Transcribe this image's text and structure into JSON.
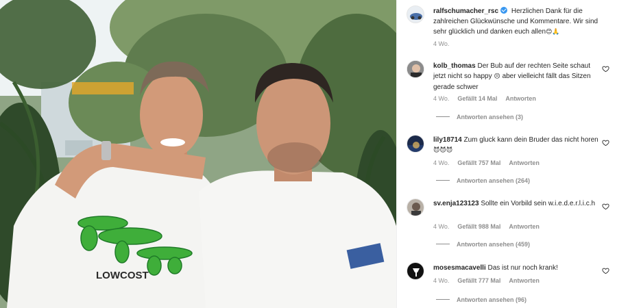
{
  "post": {
    "logo_text": "LOWCOST",
    "caption": {
      "username": "ralfschumacher_rsc",
      "text": "Herzlichen Dank für die zahlreichen Glückwünsche und Kommentare. Wir sind sehr glücklich und danken euch allen",
      "emojis": "😊🙏",
      "time": "4 Wo."
    }
  },
  "comments": [
    {
      "username": "kolb_thomas",
      "text_before": "Der Bub auf der rechten Seite schaut jetzt nicht so happy",
      "emoji": "😣",
      "text_after": "aber vielleicht fällt das Sitzen gerade schwer",
      "time": "4 Wo.",
      "likes": "Gefällt 14 Mal",
      "reply_label": "Antworten",
      "view_replies": "Antworten ansehen (3)"
    },
    {
      "username": "lily18714",
      "text_before": "Zum gluck kann dein Bruder das nicht horen",
      "emoji": "😈😈😈",
      "text_after": "",
      "time": "4 Wo.",
      "likes": "Gefällt 757 Mal",
      "reply_label": "Antworten",
      "view_replies": "Antworten ansehen (264)"
    },
    {
      "username": "sv.enja123123",
      "text_before": "Sollte ein Vorbild sein w.i.e.d.e.r.l.i.c.h",
      "emoji": "",
      "text_after": "",
      "time": "4 Wo.",
      "likes": "Gefällt 988 Mal",
      "reply_label": "Antworten",
      "view_replies": "Antworten ansehen (459)"
    },
    {
      "username": "mosesmacavelli",
      "text_before": "Das ist nur noch krank!",
      "emoji": "",
      "text_after": "",
      "time": "4 Wo.",
      "likes": "Gefällt 777 Mal",
      "reply_label": "Antworten",
      "view_replies": "Antworten ansehen (96)"
    }
  ],
  "colors": {
    "text": "#262626",
    "muted": "#8e8e8e",
    "verified": "#3897f0",
    "croc_green": "#3fae3a"
  },
  "icons": {
    "verified": "verified-badge-icon",
    "like": "heart-icon"
  }
}
